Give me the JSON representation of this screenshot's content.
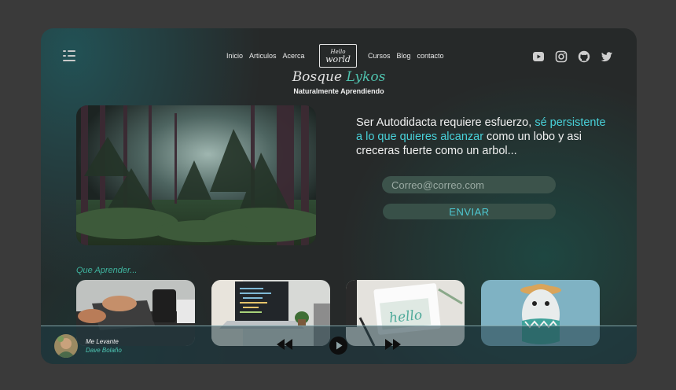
{
  "header": {
    "nav_left": [
      "Inicio",
      "Articulos",
      "Acerca"
    ],
    "logo": {
      "line1": "Hello",
      "line2": "world"
    },
    "nav_right": [
      "Cursos",
      "Blog",
      "contacto"
    ],
    "social_icons": [
      "youtube-icon",
      "instagram-icon",
      "github-icon",
      "twitter-icon"
    ]
  },
  "hero": {
    "title_part1": "Bosque",
    "title_part2": "Lykos",
    "subtitle": "Naturalmente Aprendiendo",
    "quote_start": "Ser Autodidacta requiere esfuerzo, ",
    "quote_highlight": "sé persistente a lo que quieres alcanzar",
    "quote_end": " como un lobo y asi creceras fuerte como un arbol..."
  },
  "subscribe": {
    "email_placeholder": "Correo@correo.com",
    "button_label": "ENVIAR"
  },
  "learn": {
    "section_title": "Que Aprender...",
    "cards": [
      "drawing-tablet-image",
      "laptop-code-image",
      "hello-notebook-image",
      "toy-figure-image"
    ],
    "card3_text": "hello"
  },
  "player": {
    "song_title": "Me Levante",
    "artist": "Dave Bolaño"
  },
  "colors": {
    "accent_teal": "#4fc1ad",
    "accent_cyan": "#48d1d9",
    "frame_bg": "#262929",
    "page_bg": "#3a3a3a"
  }
}
